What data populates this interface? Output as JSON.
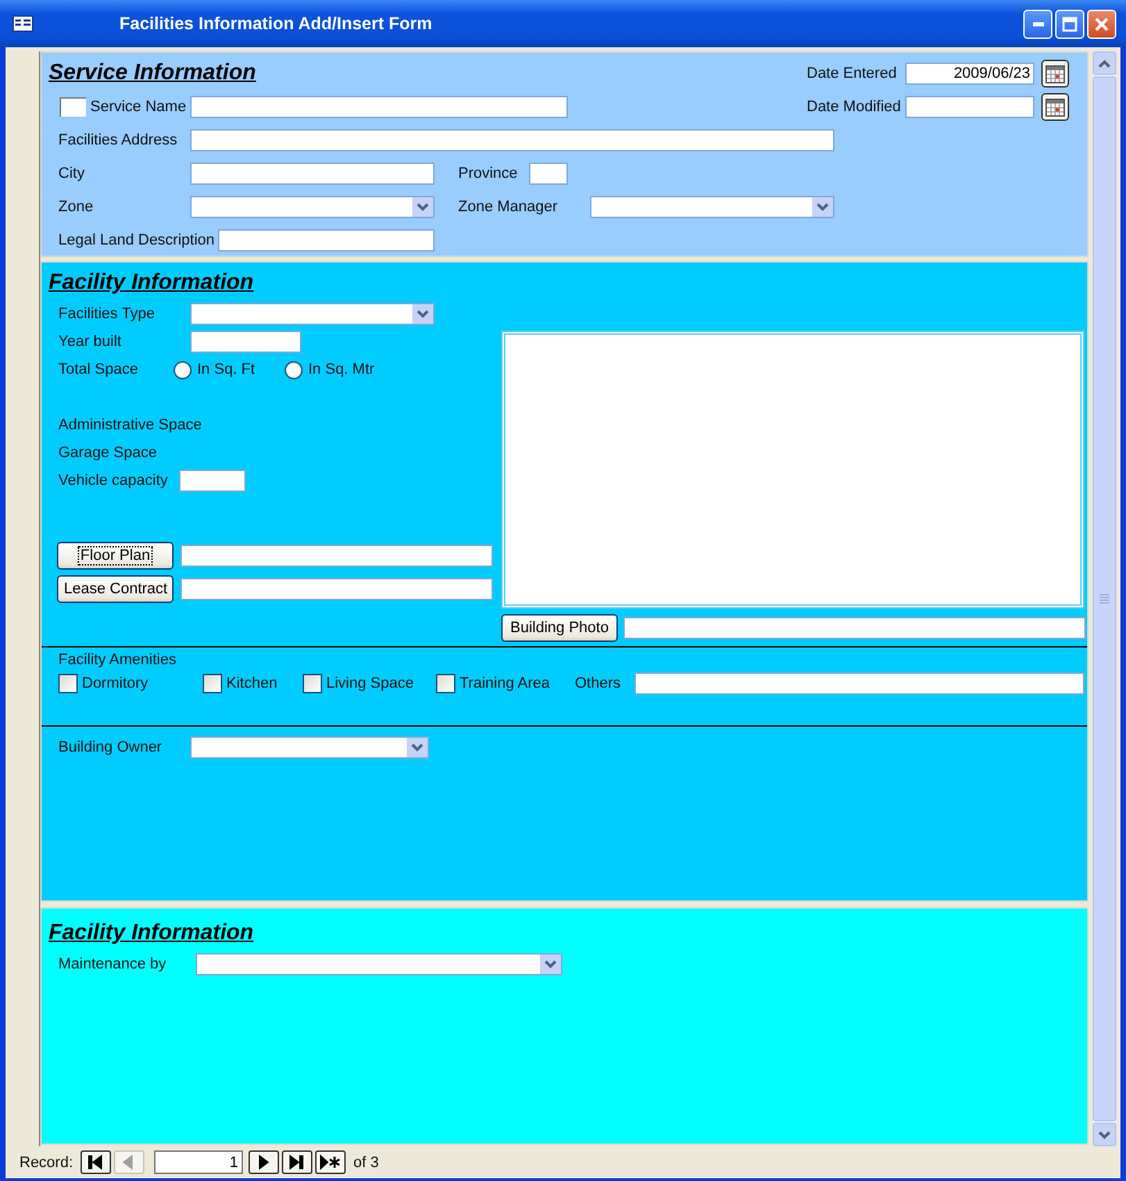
{
  "window": {
    "title": "Facilities Information Add/Insert Form"
  },
  "service_information": {
    "title": "Service Information",
    "service_checkbox": {
      "checked": false
    },
    "fields": [
      {
        "label": "Service Name",
        "kind": "text"
      },
      {
        "label": "Facilities Address",
        "kind": "text"
      },
      {
        "label": "City",
        "kind": "text"
      },
      {
        "label": "Province",
        "kind": "text"
      },
      {
        "label": "Zone",
        "kind": "combo"
      },
      {
        "label": "Zone Manager",
        "kind": "combo"
      },
      {
        "label": "Legal Land Description",
        "kind": "text"
      }
    ],
    "dates": [
      {
        "label": "Date Entered",
        "value": "2009/06/23"
      },
      {
        "label": "Date Modified"
      }
    ]
  },
  "facility_information": {
    "title": "Facility Information",
    "fields": [
      {
        "label": "Facilities Type",
        "kind": "combo"
      },
      {
        "label": "Year built",
        "kind": "text"
      }
    ],
    "total_space": {
      "label": "Total Space",
      "options": [
        {
          "label": "In Sq. Ft",
          "selected": false
        },
        {
          "label": "In Sq. Mtr",
          "selected": false
        }
      ]
    },
    "space_labels": [
      "Administrative Space",
      "Garage Space"
    ],
    "vehicle_capacity": {
      "label": "Vehicle capacity"
    },
    "attachments": [
      {
        "button": "Floor Plan",
        "focused": true
      },
      {
        "button": "Lease Contract",
        "focused": false
      }
    ],
    "building_photo": {
      "button": "Building Photo"
    },
    "amenities": {
      "label": "Facility Amenities",
      "options": [
        {
          "label": "Dormitory",
          "checked": false
        },
        {
          "label": "Kitchen",
          "checked": false
        },
        {
          "label": "Living Space",
          "checked": false
        },
        {
          "label": "Training Area",
          "checked": false
        }
      ],
      "others_label": "Others"
    },
    "building_owner": {
      "label": "Building Owner"
    }
  },
  "maintenance": {
    "title": "Facility Information",
    "field": {
      "label": "Maintenance by",
      "kind": "combo"
    }
  },
  "record_nav": {
    "label": "Record:",
    "current": "1",
    "total": "of  3",
    "buttons": [
      {
        "kind": "first",
        "disabled": false
      },
      {
        "kind": "previous",
        "disabled": true
      },
      {
        "kind": "next",
        "disabled": false
      },
      {
        "kind": "last",
        "disabled": false
      },
      {
        "kind": "new",
        "disabled": false
      }
    ]
  }
}
